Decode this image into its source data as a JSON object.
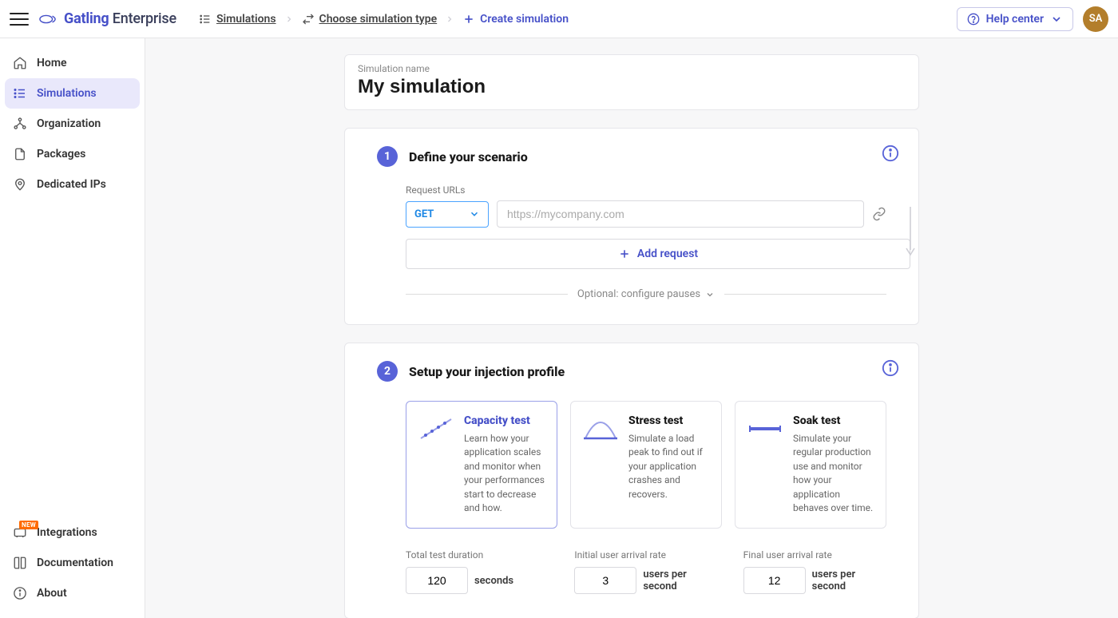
{
  "brand": {
    "name_bold": "Gatling",
    "name_light": "Enterprise"
  },
  "breadcrumbs": {
    "simulations": "Simulations",
    "choose": "Choose simulation type",
    "create": "Create simulation"
  },
  "header": {
    "help": "Help center",
    "avatar_initials": "SA"
  },
  "sidebar": {
    "home": "Home",
    "simulations": "Simulations",
    "organization": "Organization",
    "packages": "Packages",
    "dedicated_ips": "Dedicated IPs",
    "integrations": "Integrations",
    "integrations_badge": "NEW",
    "documentation": "Documentation",
    "about": "About"
  },
  "simname": {
    "label": "Simulation name",
    "value": "My simulation"
  },
  "scenario": {
    "step": "1",
    "title": "Define your scenario",
    "sub_label": "Request URLs",
    "method": "GET",
    "url_placeholder": "https://mycompany.com",
    "add_request": "Add request",
    "pauses": "Optional: configure pauses"
  },
  "injection": {
    "step": "2",
    "title": "Setup your injection profile",
    "profiles": {
      "capacity": {
        "title": "Capacity test",
        "desc": "Learn how your application scales and monitor when your performances start to decrease and how."
      },
      "stress": {
        "title": "Stress test",
        "desc": "Simulate a load peak to find out if your application crashes and recovers."
      },
      "soak": {
        "title": "Soak test",
        "desc": "Simulate your regular production use and monitor how your application behaves over time."
      }
    },
    "params": {
      "duration": {
        "label": "Total test duration",
        "value": "120",
        "unit": "seconds"
      },
      "initial": {
        "label": "Initial user arrival rate",
        "value": "3",
        "unit": "users per second"
      },
      "final": {
        "label": "Final user arrival rate",
        "value": "12",
        "unit": "users per second"
      }
    }
  }
}
